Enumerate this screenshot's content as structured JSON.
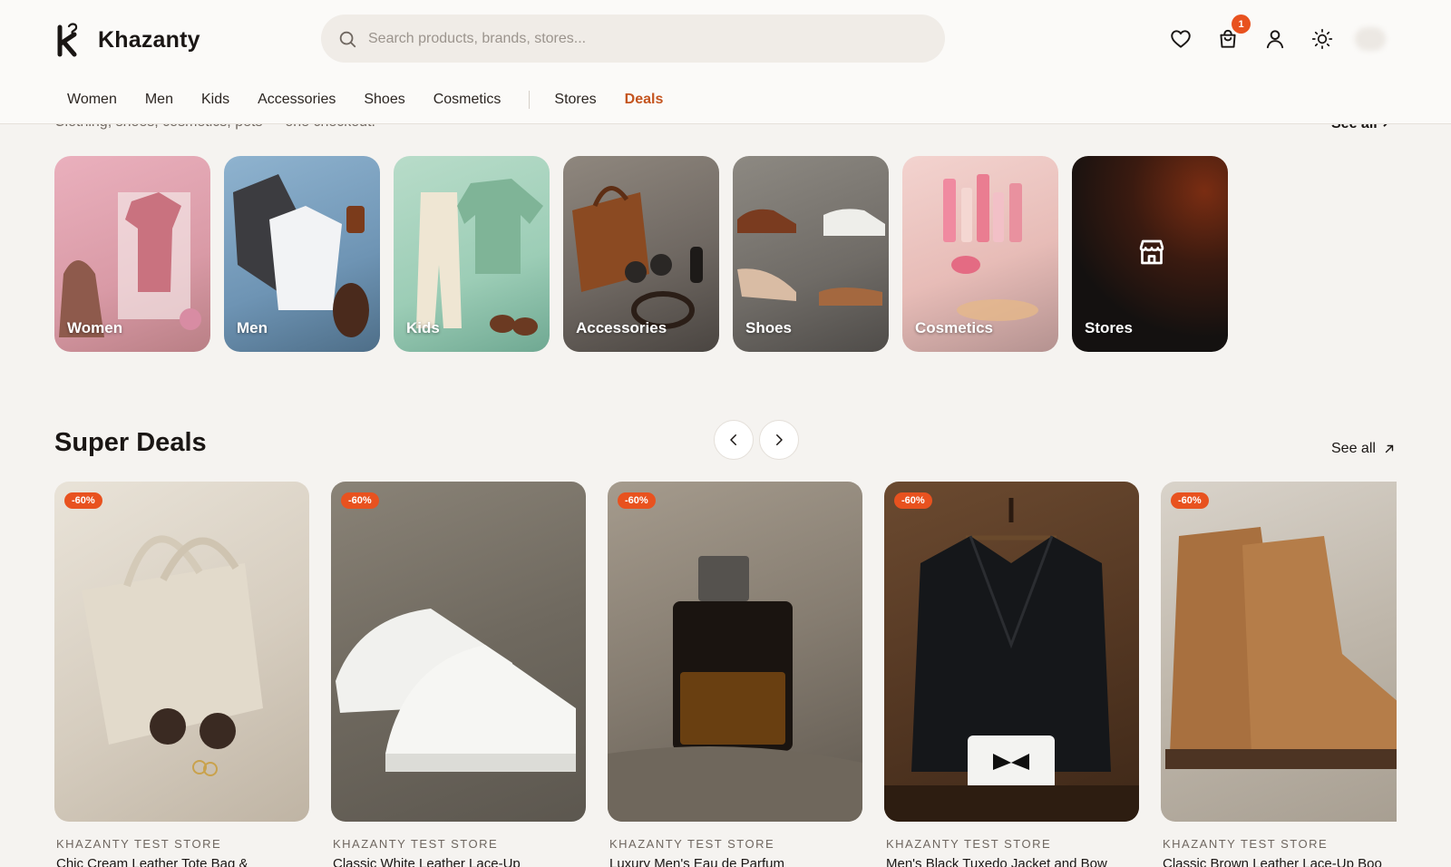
{
  "brand": {
    "name": "Khazanty"
  },
  "search": {
    "placeholder": "Search products, brands, stores..."
  },
  "cart": {
    "count": "1"
  },
  "nav": {
    "items": [
      "Women",
      "Men",
      "Kids",
      "Accessories",
      "Shoes",
      "Cosmetics"
    ],
    "stores": "Stores",
    "deals": "Deals"
  },
  "peek": {
    "subtitle": "Clothing, shoes, cosmetics, pets — one checkout.",
    "see_all": "See all ↗"
  },
  "categories": [
    {
      "label": "Women"
    },
    {
      "label": "Men"
    },
    {
      "label": "Kids"
    },
    {
      "label": "Accessories"
    },
    {
      "label": "Shoes"
    },
    {
      "label": "Cosmetics"
    },
    {
      "label": "Stores"
    }
  ],
  "super_deals": {
    "title": "Super Deals",
    "see_all": "See all",
    "products": [
      {
        "discount": "-60%",
        "store": "KHAZANTY TEST STORE",
        "name": "Chic Cream Leather Tote Bag &"
      },
      {
        "discount": "-60%",
        "store": "KHAZANTY TEST STORE",
        "name": "Classic White Leather Lace-Up"
      },
      {
        "discount": "-60%",
        "store": "KHAZANTY TEST STORE",
        "name": "Luxury Men's Eau de Parfum"
      },
      {
        "discount": "-60%",
        "store": "KHAZANTY TEST STORE",
        "name": "Men's Black Tuxedo Jacket and Bow"
      },
      {
        "discount": "-60%",
        "store": "KHAZANTY TEST STORE",
        "name": "Classic Brown Leather Lace-Up Boo"
      }
    ]
  },
  "colors": {
    "accent": "#e8521f",
    "deals_link": "#c4541e",
    "dark_tile": "#141110"
  }
}
